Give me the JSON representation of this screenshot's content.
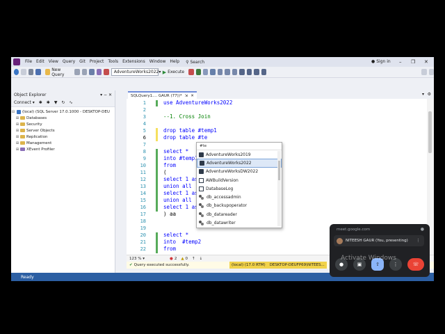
{
  "menu": {
    "items": [
      "File",
      "Edit",
      "View",
      "Query",
      "Git",
      "Project",
      "Tools",
      "Extensions",
      "Window",
      "Help"
    ],
    "search": "Search",
    "signin": "Sign in"
  },
  "toolbar": {
    "new_query": "New Query",
    "database": "AdventureWorks2022",
    "execute": "Execute"
  },
  "object_explorer": {
    "title": "Object Explorer",
    "connect": "Connect",
    "server": "(local) (SQL Server 17.0.1000 - DESKTOP-DEUFP69\\NITEESH GAUR)",
    "nodes": [
      "Databases",
      "Security",
      "Server Objects",
      "Replication",
      "Management",
      "XEvent Profiler"
    ]
  },
  "editor": {
    "tab_label": "SQLQuery1.... GAUR (77))*",
    "line_numbers": [
      "1",
      "2",
      "3",
      "4",
      "5",
      "6",
      "7",
      "8",
      "9",
      "10",
      "11",
      "12",
      "13",
      "14",
      "15",
      "16",
      "17",
      "18",
      "19",
      "20",
      "21",
      "22"
    ],
    "lines": {
      "l1": "use AdventureWorks2022",
      "l3": "--1. Cross Join",
      "l5": "drop table #temp1",
      "l6": "drop table #te",
      "l8": "select *",
      "l9": "into #temp1",
      "l10": "from",
      "l11": "(",
      "l12": "select 1 as",
      "l13": "union all",
      "l14": "select 1 as",
      "l15": "union all",
      "l16": "select 1 as",
      "l17": ") aa",
      "l20": "select *",
      "l21": "into  #temp2",
      "l22": "from"
    }
  },
  "intellisense": {
    "filter": "#te",
    "items": [
      {
        "label": "AdventureWorks2019",
        "icon": "database-icon"
      },
      {
        "label": "AdventureWorks2022",
        "icon": "database-icon"
      },
      {
        "label": "AdventureWorksDW2022",
        "icon": "database-icon"
      },
      {
        "label": "AWBuildVersion",
        "icon": "table-icon"
      },
      {
        "label": "DatabaseLog",
        "icon": "table-icon"
      },
      {
        "label": "db_accessadmin",
        "icon": "role-icon"
      },
      {
        "label": "db_backupoperator",
        "icon": "role-icon"
      },
      {
        "label": "db_datareader",
        "icon": "role-icon"
      },
      {
        "label": "db_datawriter",
        "icon": "role-icon"
      }
    ]
  },
  "footer": {
    "zoom": "123 %",
    "errors": "2",
    "warnings": "0"
  },
  "query_status": {
    "message": "Query executed successfully.",
    "server": "(local) (17.0 RTM)",
    "connection": "DESKTOP-DEUFP69\\NITEES..."
  },
  "statusbar": {
    "text": "Ready"
  },
  "meet": {
    "url": "meet.google.com",
    "presenter": "NITEESH GAUR (You, presenting)"
  },
  "watermark": "Activate Windows"
}
